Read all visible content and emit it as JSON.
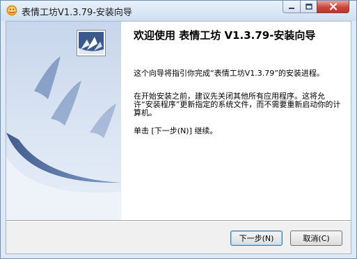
{
  "window": {
    "title": "表情工坊V1.3.79-安装向导"
  },
  "main": {
    "heading": "欢迎使用 表情工坊 V1.3.79-安装向导",
    "paragraphs": [
      "这个向导将指引你完成“表情工坊V1.3.79”的安装进程。",
      "在开始安装之前，建议先关闭其他所有应用程序。这将允许“安装程序”更新指定的系统文件，而不需要重新启动你的计算机。",
      "单击 [下一步(N)] 继续。"
    ]
  },
  "buttons": {
    "next": "下一步(N)",
    "cancel": "取消(C)"
  },
  "icons": {
    "app": "app-icon",
    "installer": "installer-logo-icon",
    "minimize": "minimize-icon",
    "maximize": "maximize-icon",
    "close": "close-icon"
  },
  "colors": {
    "title_bar": "#cfdff0",
    "sidebar_gradient_top": "#c7d6ec",
    "sidebar_gradient_bottom": "#e6eef8",
    "accent_wave": "#3d5f9a",
    "close_button": "#c9463a"
  }
}
